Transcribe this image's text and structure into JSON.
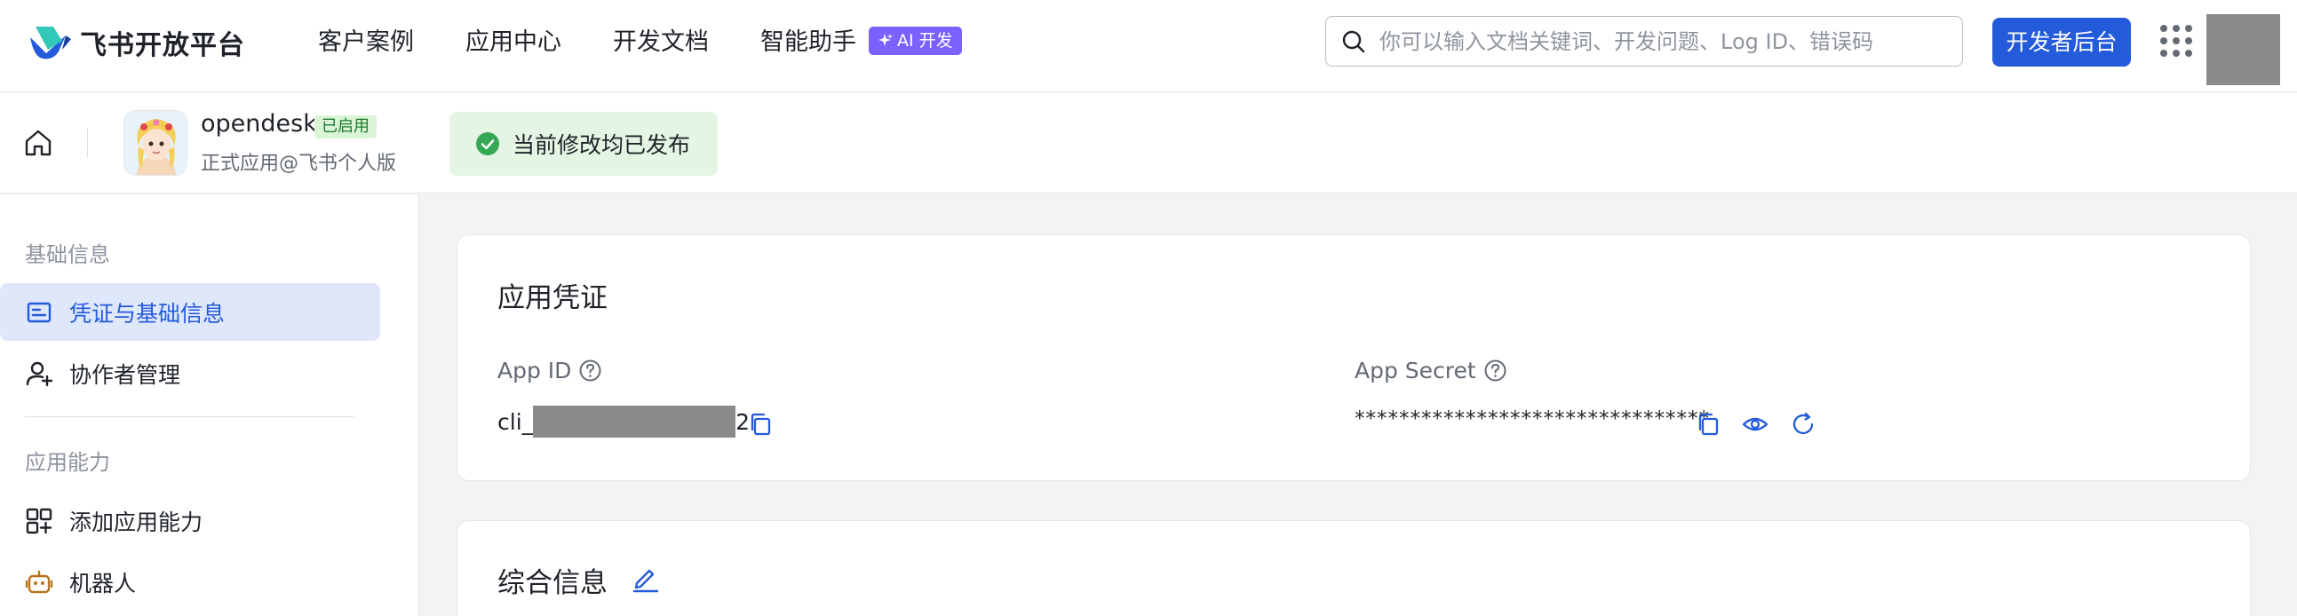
{
  "brand": {
    "logo_text": "飞书开放平台"
  },
  "nav": {
    "items": [
      "客户案例",
      "应用中心",
      "开发文档",
      "智能助手"
    ],
    "ai_badge": "AI 开发",
    "search_placeholder": "你可以输入文档关键词、开发问题、Log ID、错误码",
    "dev_console_label": "开发者后台"
  },
  "app": {
    "name": "opendesk",
    "status": "已启用",
    "subtitle": "正式应用@飞书个人版",
    "publish_status": "当前修改均已发布"
  },
  "sidebar": {
    "sections": [
      {
        "title": "基础信息",
        "items": [
          {
            "label": "凭证与基础信息",
            "icon": "credential-icon",
            "active": true
          },
          {
            "label": "协作者管理",
            "icon": "collaborator-icon",
            "active": false
          }
        ]
      },
      {
        "title": "应用能力",
        "items": [
          {
            "label": "添加应用能力",
            "icon": "add-capability-icon",
            "active": false
          },
          {
            "label": "机器人",
            "icon": "robot-icon",
            "active": false
          }
        ]
      }
    ]
  },
  "credentials": {
    "title": "应用凭证",
    "app_id_label": "App ID",
    "app_id_prefix": "cli_",
    "app_id_suffix": "2",
    "app_secret_label": "App Secret",
    "app_secret_value": "********************************"
  },
  "general": {
    "title": "综合信息"
  },
  "colors": {
    "primary": "#245bdb",
    "ai_badge": "#7b61ff",
    "success_bg": "#e4f6e3",
    "success_icon": "#34a853",
    "active_nav_bg": "#dfe7fb"
  }
}
